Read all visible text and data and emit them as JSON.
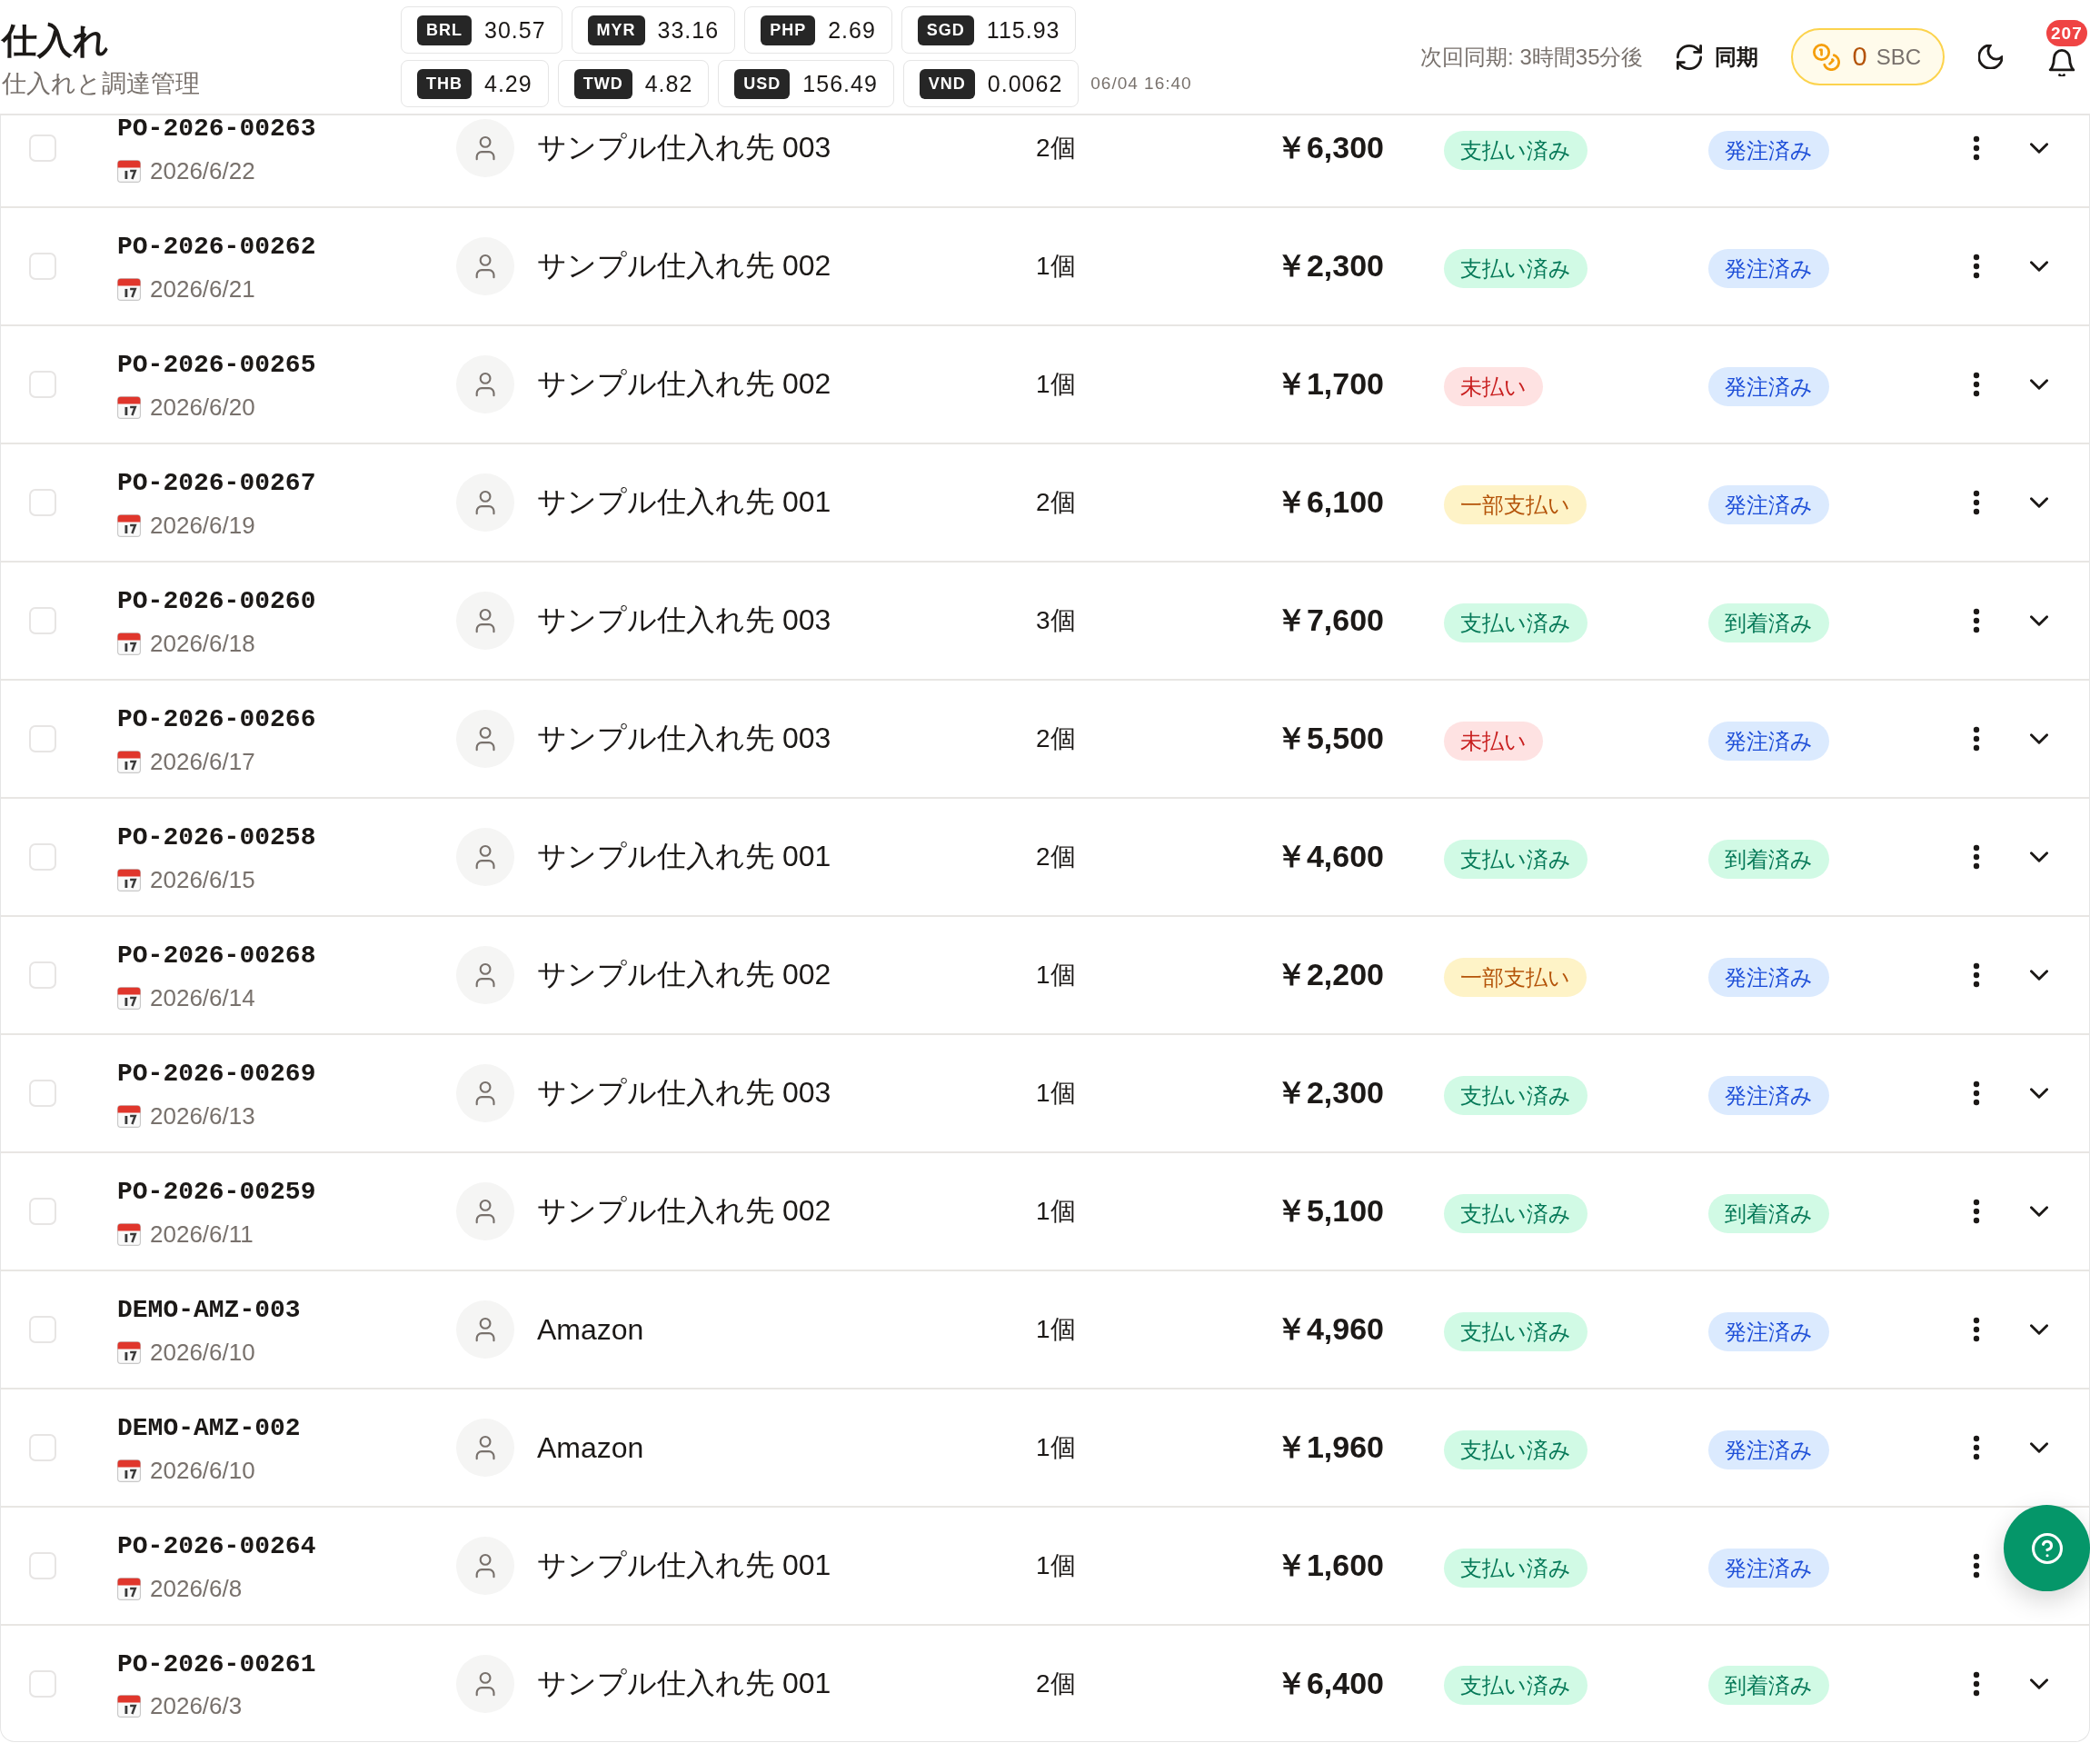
{
  "header": {
    "title": "仕入れ",
    "subtitle": "仕入れと調達管理",
    "rate_rows": [
      [
        {
          "code": "BRL",
          "rate": "30.57"
        },
        {
          "code": "MYR",
          "rate": "33.16"
        },
        {
          "code": "PHP",
          "rate": "2.69"
        },
        {
          "code": "SGD",
          "rate": "115.93"
        }
      ],
      [
        {
          "code": "THB",
          "rate": "4.29"
        },
        {
          "code": "TWD",
          "rate": "4.82"
        },
        {
          "code": "USD",
          "rate": "156.49"
        },
        {
          "code": "VND",
          "rate": "0.0062"
        }
      ]
    ],
    "rates_updated": "06/04 16:40",
    "next_sync": "次回同期: 3時間35分後",
    "sync_button": "同期",
    "points": {
      "value": "0",
      "unit": "SBC"
    },
    "notification_count": "207"
  },
  "orders": [
    {
      "checked": false,
      "po_number": "PO-2026-00263",
      "date": "2026/6/22",
      "supplier": "サンプル仕入れ先 003",
      "quantity": "2個",
      "amount": "￥6,300",
      "payment": {
        "label": "支払い済み",
        "kind": "paid"
      },
      "status": {
        "label": "発注済み",
        "kind": "ordered"
      },
      "expanded": false
    },
    {
      "checked": false,
      "po_number": "PO-2026-00262",
      "date": "2026/6/21",
      "supplier": "サンプル仕入れ先 002",
      "quantity": "1個",
      "amount": "￥2,300",
      "payment": {
        "label": "支払い済み",
        "kind": "paid"
      },
      "status": {
        "label": "発注済み",
        "kind": "ordered"
      },
      "expanded": false
    },
    {
      "checked": false,
      "po_number": "PO-2026-00265",
      "date": "2026/6/20",
      "supplier": "サンプル仕入れ先 002",
      "quantity": "1個",
      "amount": "￥1,700",
      "payment": {
        "label": "未払い",
        "kind": "unpaid"
      },
      "status": {
        "label": "発注済み",
        "kind": "ordered"
      },
      "expanded": false
    },
    {
      "checked": false,
      "po_number": "PO-2026-00267",
      "date": "2026/6/19",
      "supplier": "サンプル仕入れ先 001",
      "quantity": "2個",
      "amount": "￥6,100",
      "payment": {
        "label": "一部支払い",
        "kind": "partial"
      },
      "status": {
        "label": "発注済み",
        "kind": "ordered"
      },
      "expanded": false
    },
    {
      "checked": false,
      "po_number": "PO-2026-00260",
      "date": "2026/6/18",
      "supplier": "サンプル仕入れ先 003",
      "quantity": "3個",
      "amount": "￥7,600",
      "payment": {
        "label": "支払い済み",
        "kind": "paid"
      },
      "status": {
        "label": "到着済み",
        "kind": "arrived"
      },
      "expanded": false
    },
    {
      "checked": false,
      "po_number": "PO-2026-00266",
      "date": "2026/6/17",
      "supplier": "サンプル仕入れ先 003",
      "quantity": "2個",
      "amount": "￥5,500",
      "payment": {
        "label": "未払い",
        "kind": "unpaid"
      },
      "status": {
        "label": "発注済み",
        "kind": "ordered"
      },
      "expanded": false
    },
    {
      "checked": false,
      "po_number": "PO-2026-00258",
      "date": "2026/6/15",
      "supplier": "サンプル仕入れ先 001",
      "quantity": "2個",
      "amount": "￥4,600",
      "payment": {
        "label": "支払い済み",
        "kind": "paid"
      },
      "status": {
        "label": "到着済み",
        "kind": "arrived"
      },
      "expanded": false
    },
    {
      "checked": false,
      "po_number": "PO-2026-00268",
      "date": "2026/6/14",
      "supplier": "サンプル仕入れ先 002",
      "quantity": "1個",
      "amount": "￥2,200",
      "payment": {
        "label": "一部支払い",
        "kind": "partial"
      },
      "status": {
        "label": "発注済み",
        "kind": "ordered"
      },
      "expanded": false
    },
    {
      "checked": false,
      "po_number": "PO-2026-00269",
      "date": "2026/6/13",
      "supplier": "サンプル仕入れ先 003",
      "quantity": "1個",
      "amount": "￥2,300",
      "payment": {
        "label": "支払い済み",
        "kind": "paid"
      },
      "status": {
        "label": "発注済み",
        "kind": "ordered"
      },
      "expanded": false
    },
    {
      "checked": false,
      "po_number": "PO-2026-00259",
      "date": "2026/6/11",
      "supplier": "サンプル仕入れ先 002",
      "quantity": "1個",
      "amount": "￥5,100",
      "payment": {
        "label": "支払い済み",
        "kind": "paid"
      },
      "status": {
        "label": "到着済み",
        "kind": "arrived"
      },
      "expanded": false
    },
    {
      "checked": false,
      "po_number": "DEMO-AMZ-003",
      "date": "2026/6/10",
      "supplier": "Amazon",
      "quantity": "1個",
      "amount": "￥4,960",
      "payment": {
        "label": "支払い済み",
        "kind": "paid"
      },
      "status": {
        "label": "発注済み",
        "kind": "ordered"
      },
      "expanded": false
    },
    {
      "checked": false,
      "po_number": "DEMO-AMZ-002",
      "date": "2026/6/10",
      "supplier": "Amazon",
      "quantity": "1個",
      "amount": "￥1,960",
      "payment": {
        "label": "支払い済み",
        "kind": "paid"
      },
      "status": {
        "label": "発注済み",
        "kind": "ordered"
      },
      "expanded": false
    },
    {
      "checked": false,
      "po_number": "PO-2026-00264",
      "date": "2026/6/8",
      "supplier": "サンプル仕入れ先 001",
      "quantity": "1個",
      "amount": "￥1,600",
      "payment": {
        "label": "支払い済み",
        "kind": "paid"
      },
      "status": {
        "label": "発注済み",
        "kind": "ordered"
      }
    },
    {
      "checked": false,
      "po_number": "PO-2026-00261",
      "date": "2026/6/3",
      "supplier": "サンプル仕入れ先 001",
      "quantity": "2個",
      "amount": "￥6,400",
      "payment": {
        "label": "支払い済み",
        "kind": "paid"
      },
      "status": {
        "label": "到着済み",
        "kind": "arrived"
      },
      "expanded": false
    }
  ]
}
